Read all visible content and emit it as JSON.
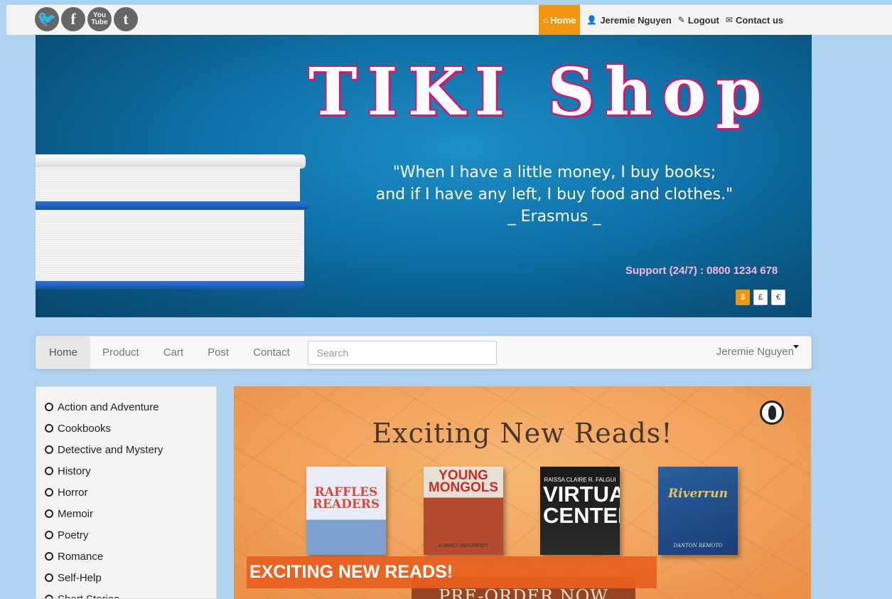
{
  "social": [
    {
      "name": "twitter",
      "glyph": "🐦"
    },
    {
      "name": "facebook",
      "glyph": "f"
    },
    {
      "name": "youtube",
      "glyph": "You Tube"
    },
    {
      "name": "tumblr",
      "glyph": "t"
    }
  ],
  "topnav": {
    "home": "Home",
    "user": "Jeremie Nguyen",
    "logout": "Logout",
    "contact": "Contact us"
  },
  "banner": {
    "logo": "TIKI Shop",
    "quote_line1": "\"When I have a little money, I buy books;",
    "quote_line2": "and if I have any left, I buy food and clothes.\"",
    "quote_author": "_ Erasmus _",
    "support": "Support (24/7) : 0800 1234 678",
    "currencies": [
      "$",
      "£",
      "€"
    ]
  },
  "navbar": {
    "items": [
      "Home",
      "Product",
      "Cart",
      "Post",
      "Contact"
    ],
    "search_placeholder": "Search",
    "user": "Jeremie Nguyen"
  },
  "categories": [
    "Action and Adventure",
    "Cookbooks",
    "Detective and Mystery",
    "History",
    "Horror",
    "Memoir",
    "Poetry",
    "Romance",
    "Self-Help",
    "Short Stories"
  ],
  "promo": {
    "title": "Exciting New Reads!",
    "books": [
      {
        "title": "RAFFLES READERS",
        "author": ""
      },
      {
        "title": "YOUNG MONGOLS",
        "author": "AUBREY MENARNDY"
      },
      {
        "title_small": "RAISSA CLAIRE R. FALGUI",
        "title": "VIRTUAL CENTER"
      },
      {
        "title": "Riverrun",
        "author": "DANTON REMOTO"
      }
    ],
    "strip": "EXCITING NEW READS!",
    "cta": "PRE-ORDER NOW"
  },
  "colors": {
    "accent": "#f0970f",
    "page_bg": "#aed2f0",
    "logo_outline": "#d4196a",
    "support_text": "#f7b8dc"
  }
}
